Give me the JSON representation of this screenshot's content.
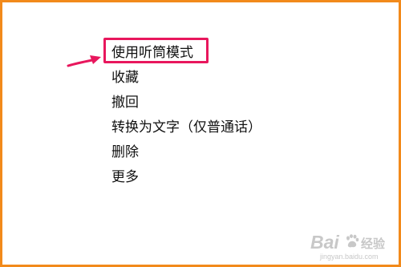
{
  "menu": {
    "items": [
      {
        "label": "使用听筒模式",
        "highlighted": true
      },
      {
        "label": "收藏",
        "highlighted": false
      },
      {
        "label": "撤回",
        "highlighted": false
      },
      {
        "label": "转换为文字（仅普通话）",
        "highlighted": false
      },
      {
        "label": "删除",
        "highlighted": false
      },
      {
        "label": "更多",
        "highlighted": false
      }
    ]
  },
  "annotation": {
    "highlight_color": "#e8175d",
    "arrow_color": "#e8175d",
    "frame_color": "#f28a1b"
  },
  "watermark": {
    "brand": "Bai",
    "brand_suffix": "经验",
    "url": "jingyan.baidu.com",
    "icon": "baidu-paw-icon"
  }
}
